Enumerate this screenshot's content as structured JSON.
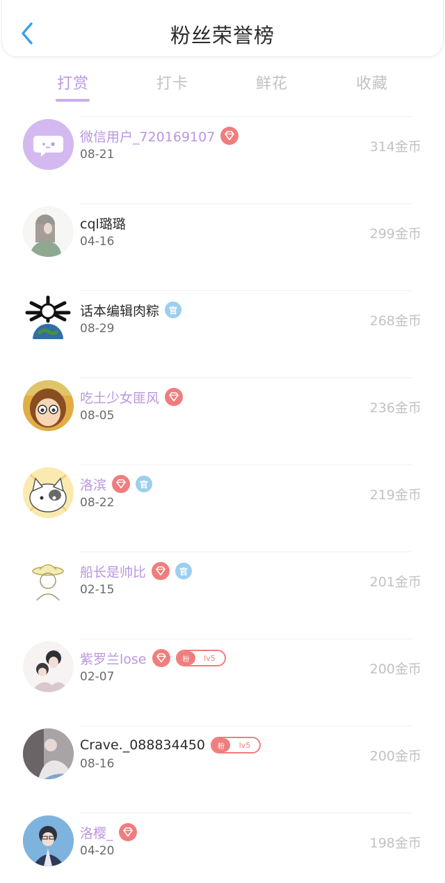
{
  "header": {
    "title": "粉丝荣誉榜",
    "back_icon": "chevron-left-icon"
  },
  "tabs": [
    {
      "label": "打赏",
      "active": true
    },
    {
      "label": "打卡",
      "active": false
    },
    {
      "label": "鲜花",
      "active": false
    },
    {
      "label": "收藏",
      "active": false
    }
  ],
  "colors": {
    "accent": "#b99be1",
    "gem": "#f07d7d",
    "guan": "#9ccfee",
    "vip_name": "#b996e0"
  },
  "badges": {
    "guan_text": "官",
    "fan_text": "粉",
    "fan_level": "lv5"
  },
  "fans": [
    {
      "name": "微信用户_720169107",
      "date": "08-21",
      "coins": "314金币",
      "vip": true
    },
    {
      "name": "cql璐璐",
      "date": "04-16",
      "coins": "299金币",
      "vip": false
    },
    {
      "name": "话本编辑肉粽",
      "date": "08-29",
      "coins": "268金币",
      "vip": false
    },
    {
      "name": "吃土少女匪风",
      "date": "08-05",
      "coins": "236金币",
      "vip": true
    },
    {
      "name": "洛滨",
      "date": "08-22",
      "coins": "219金币",
      "vip": true
    },
    {
      "name": "船长是帅比",
      "date": "02-15",
      "coins": "201金币",
      "vip": true
    },
    {
      "name": "紫罗兰lose",
      "date": "02-07",
      "coins": "200金币",
      "vip": true
    },
    {
      "name": "Crave._088834450",
      "date": "08-16",
      "coins": "200金币",
      "vip": false
    },
    {
      "name": "洛樱_",
      "date": "04-20",
      "coins": "198金币",
      "vip": true
    }
  ]
}
